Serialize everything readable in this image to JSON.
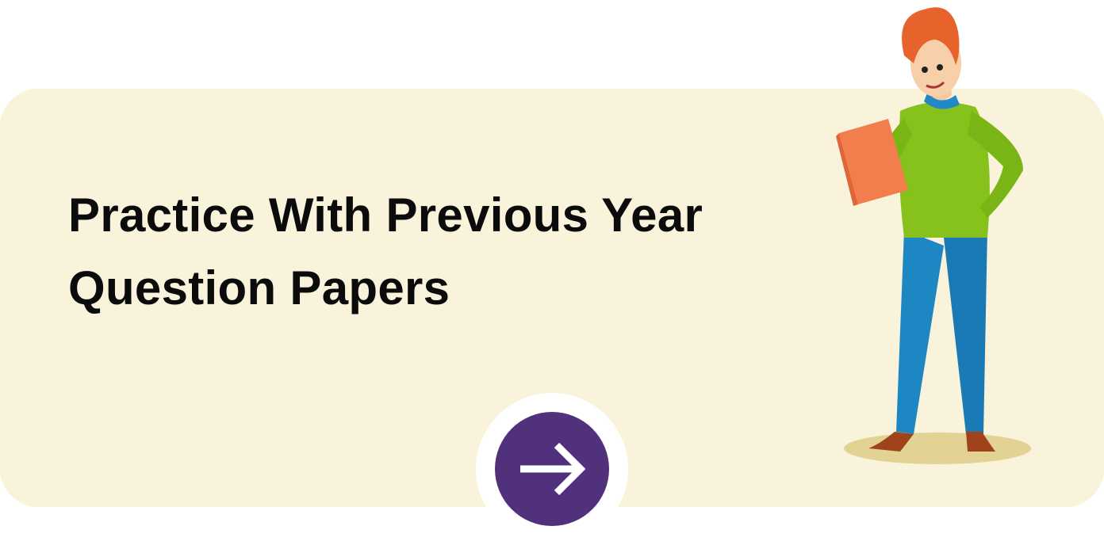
{
  "banner": {
    "title_line1": "Practice With Previous Year",
    "title_line2": "Question Papers",
    "arrow_button_icon": "arrow-right-icon",
    "colors": {
      "card": "#f9f3dc",
      "button": "#51307c"
    }
  }
}
